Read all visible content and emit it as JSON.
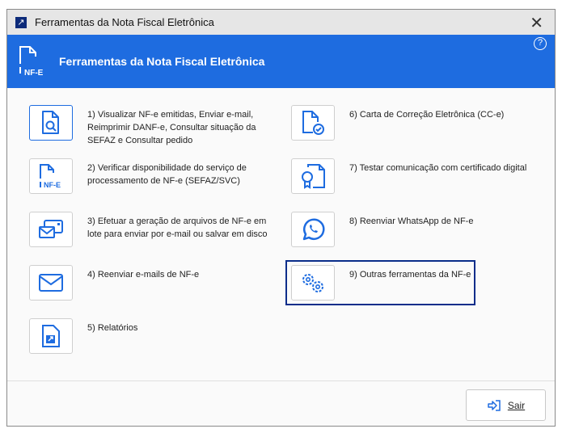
{
  "window": {
    "title": "Ferramentas da Nota Fiscal Eletrônica"
  },
  "header": {
    "title": "Ferramentas da Nota Fiscal Eletrônica",
    "help": "?",
    "icon_text": "NF-E"
  },
  "items": [
    {
      "label": "1) Visualizar NF-e emitidas, Enviar e-mail, Reimprimir DANF-e, Consultar situação da SEFAZ e Consultar pedido",
      "icon": "document-search-icon"
    },
    {
      "label": "2) Verificar disponibilidade do serviço de processamento de NF-e (SEFAZ/SVC)",
      "icon": "nfe-document-icon",
      "icon_text": "NF-E"
    },
    {
      "label": "3) Efetuar a geração de arquivos de NF-e em lote para enviar por e-mail ou salvar em disco",
      "icon": "batch-mail-icon"
    },
    {
      "label": "4) Reenviar e-mails de NF-e",
      "icon": "envelope-icon"
    },
    {
      "label": "5) Relatórios",
      "icon": "report-icon"
    },
    {
      "label": "6) Carta de Correção Eletrônica (CC-e)",
      "icon": "document-check-icon"
    },
    {
      "label": "7) Testar comunicação com certificado digital",
      "icon": "certificate-icon"
    },
    {
      "label": "8) Reenviar WhatsApp de NF-e",
      "icon": "whatsapp-icon"
    },
    {
      "label": "9) Outras ferramentas da NF-e",
      "icon": "gears-icon"
    }
  ],
  "footer": {
    "exit_label": "Sair"
  }
}
